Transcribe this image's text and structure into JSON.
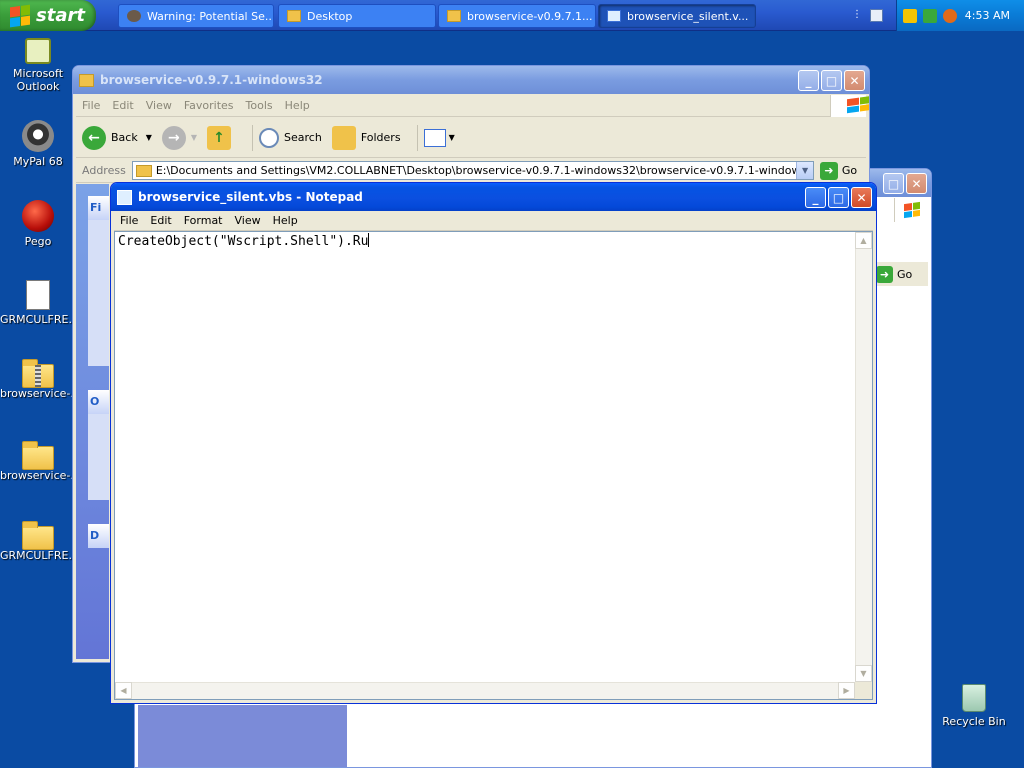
{
  "taskbar": {
    "start_label": "start",
    "tasks": [
      {
        "label": "Warning: Potential Se...",
        "icon": "raccoon-icon"
      },
      {
        "label": "Desktop",
        "icon": "folder-icon"
      },
      {
        "label": "browservice-v0.9.7.1...",
        "icon": "folder-icon"
      },
      {
        "label": "browservice_silent.v...",
        "icon": "notepad-icon"
      }
    ],
    "clock": "4:53 AM"
  },
  "desktop_icons": [
    {
      "label": "Microsoft Outlook",
      "icon": "outlook-icon"
    },
    {
      "label": "MyPal 68",
      "icon": "mypal-icon"
    },
    {
      "label": "Pego",
      "icon": "pego-icon"
    },
    {
      "label": "GRMCULFRE...",
      "icon": "program-icon"
    },
    {
      "label": "browservice-...",
      "icon": "zip-folder-icon"
    },
    {
      "label": "browservice-...",
      "icon": "folder-icon"
    },
    {
      "label": "GRMCULFRE...",
      "icon": "folder-icon"
    },
    {
      "label": "Recycle Bin",
      "icon": "recycle-bin-icon"
    }
  ],
  "explorer": {
    "title": "browservice-v0.9.7.1-windows32",
    "menu": [
      "File",
      "Edit",
      "View",
      "Favorites",
      "Tools",
      "Help"
    ],
    "toolbar": {
      "back": "Back",
      "search": "Search",
      "folders": "Folders"
    },
    "address_label": "Address",
    "address_value": "E:\\Documents and Settings\\VM2.COLLABNET\\Desktop\\browservice-v0.9.7.1-windows32\\browservice-v0.9.7.1-windows32",
    "go_label": "Go",
    "pane_headers": [
      "Fi",
      "O",
      "D"
    ]
  },
  "explorer2": {
    "go_label": "Go"
  },
  "notepad": {
    "title": "browservice_silent.vbs - Notepad",
    "menu": [
      "File",
      "Edit",
      "Format",
      "View",
      "Help"
    ],
    "content": "CreateObject(\"Wscript.Shell\").Ru"
  },
  "colors": {
    "xp_blue": "#0a4ba3",
    "title_active": "#0554e3",
    "start_green": "#3a9d3a"
  }
}
